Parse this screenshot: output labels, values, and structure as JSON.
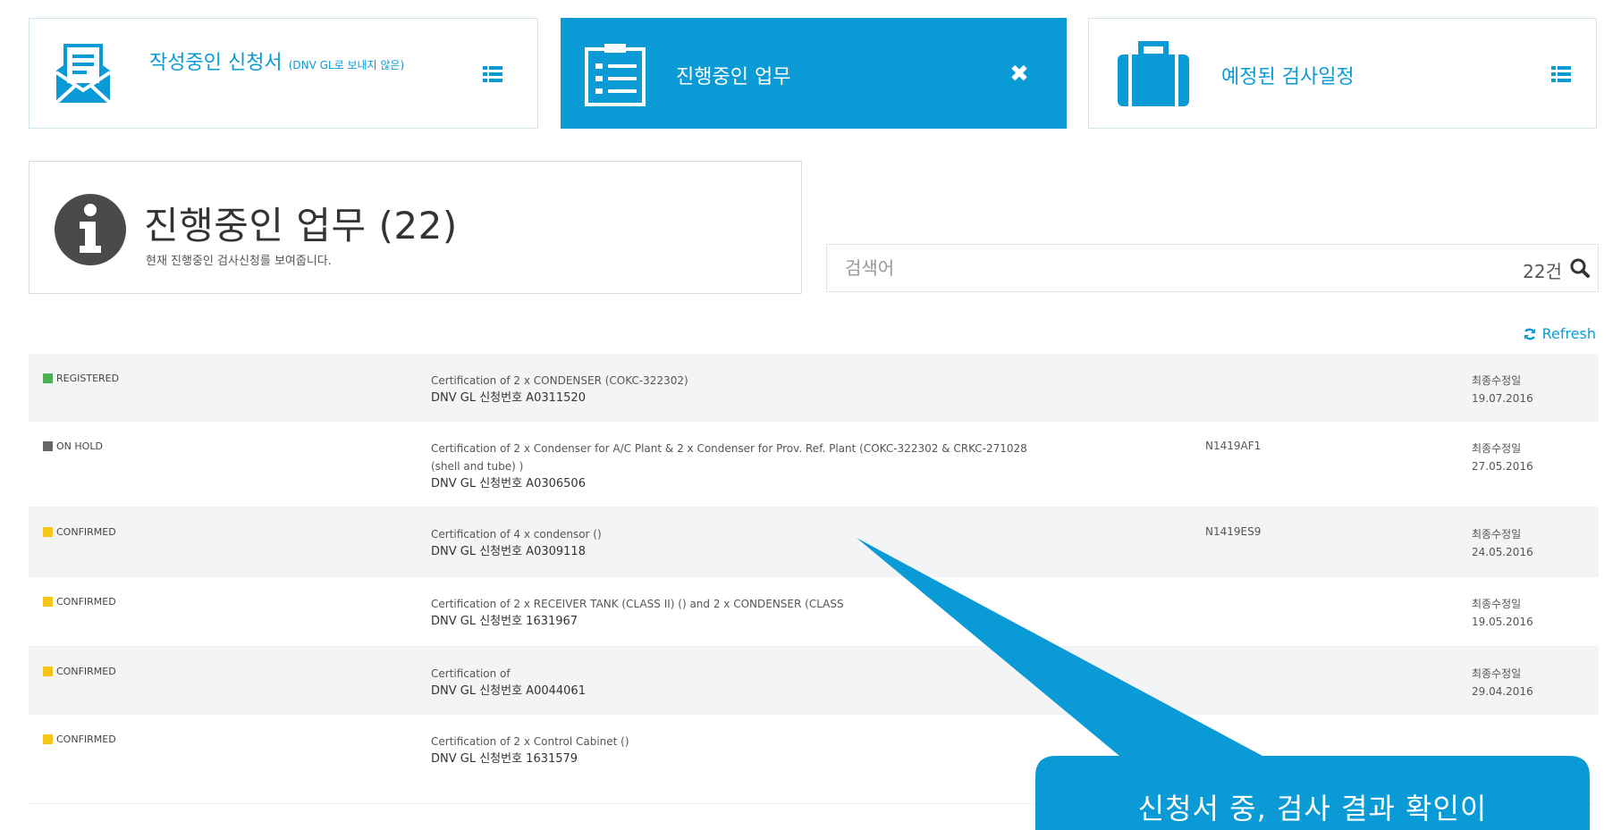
{
  "colors": {
    "accent": "#0a9bd6",
    "registered": "#4caf50",
    "on_hold": "#666666",
    "confirmed": "#f5c518"
  },
  "cards": {
    "drafts": {
      "title": "작성중인 신청서",
      "subtitle": "(DNV GL로 보내지 않은)",
      "icon": "envelope-form-icon",
      "action_icon": "list-icon"
    },
    "in_progress": {
      "title": "진행중인 업무",
      "icon": "checklist-icon",
      "action_icon": "close-icon"
    },
    "scheduled": {
      "title": "예정된 검사일정",
      "icon": "briefcase-icon",
      "action_icon": "list-icon"
    }
  },
  "info": {
    "title": "진행중인 업무 (22)",
    "subtitle": "현재 진행중인 검사신청를 보여줍니다.",
    "icon": "info-icon"
  },
  "search": {
    "placeholder": "검색어",
    "count": "22건",
    "icon": "search-icon"
  },
  "refresh_label": "Refresh",
  "rows": [
    {
      "status": "REGISTERED",
      "status_color": "#4caf50",
      "desc_line1": "Certification of 2 x CONDENSER (COKC-322302)",
      "desc_line2": "",
      "application_no": "DNV GL 신청번호 A0311520",
      "ref": "",
      "date_label": "최종수정일",
      "date": "19.07.2016"
    },
    {
      "status": "ON HOLD",
      "status_color": "#666666",
      "desc_line1": "Certification of 2 x Condenser for A/C Plant & 2 x Condenser for Prov. Ref. Plant (COKC-322302 & CRKC-271028",
      "desc_line2": "(shell and tube) )",
      "application_no": "DNV GL 신청번호 A0306506",
      "ref": "N1419AF1",
      "date_label": "최종수정일",
      "date": "27.05.2016"
    },
    {
      "status": "CONFIRMED",
      "status_color": "#f5c518",
      "desc_line1": "Certification of 4 x condensor ()",
      "desc_line2": "",
      "application_no": "DNV GL 신청번호 A0309118",
      "ref": "N1419ES9",
      "date_label": "최종수정일",
      "date": "24.05.2016"
    },
    {
      "status": "CONFIRMED",
      "status_color": "#f5c518",
      "desc_line1": "Certification of 2 x RECEIVER TANK (CLASS II) () and 2 x CONDENSER (CLASS",
      "desc_line2": "",
      "application_no": "DNV GL 신청번호 1631967",
      "ref": "",
      "date_label": "최종수정일",
      "date": "19.05.2016"
    },
    {
      "status": "CONFIRMED",
      "status_color": "#f5c518",
      "desc_line1": "Certification of",
      "desc_line2": "",
      "application_no": "DNV GL 신청번호 A0044061",
      "ref": "",
      "date_label": "최종수정일",
      "date": "29.04.2016"
    },
    {
      "status": "CONFIRMED",
      "status_color": "#f5c518",
      "desc_line1": "Certification of 2 x Control Cabinet ()",
      "desc_line2": "",
      "application_no": "DNV GL 신청번호 1631579",
      "ref": "",
      "date_label": "",
      "date": ""
    }
  ],
  "callout": {
    "text": "신청서 중, 검사 결과 확인이"
  }
}
